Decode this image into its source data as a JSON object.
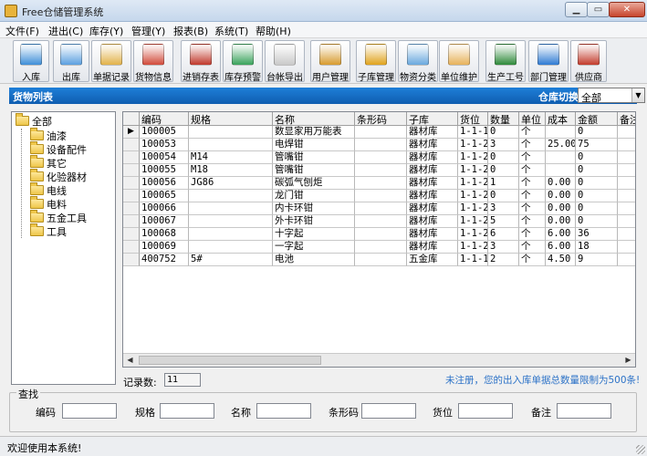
{
  "window": {
    "title": "Free仓储管理系统"
  },
  "menu": [
    "文件(F)",
    "进出(C)",
    "库存(Y)",
    "管理(Y)",
    "报表(B)",
    "系统(T)",
    "帮助(H)"
  ],
  "toolbar": [
    {
      "label": "入库",
      "icon": "warehouse-in-icon",
      "color": "#3f8fd8"
    },
    {
      "label": "出库",
      "icon": "warehouse-out-icon",
      "color": "#5ba0e0"
    },
    {
      "label": "单据记录",
      "icon": "document-edit-icon",
      "color": "#e2b24a"
    },
    {
      "label": "货物信息",
      "icon": "goods-info-icon",
      "color": "#d14a3a"
    },
    {
      "label": "进销存表",
      "icon": "report-table-icon",
      "color": "#c0392b"
    },
    {
      "label": "库存预警",
      "icon": "monitor-alert-icon",
      "color": "#3aa35b"
    },
    {
      "label": "台帐导出",
      "icon": "export-icon",
      "color": "#c9c9c9"
    },
    {
      "label": "用户管理",
      "icon": "user-icon",
      "color": "#d79b2e"
    },
    {
      "label": "子库管理",
      "icon": "sub-warehouse-icon",
      "color": "#e0a31c"
    },
    {
      "label": "物资分类",
      "icon": "category-icon",
      "color": "#6aa9de"
    },
    {
      "label": "单位维护",
      "icon": "unit-icon",
      "color": "#e7b25a"
    },
    {
      "label": "生产工号",
      "icon": "production-chart-icon",
      "color": "#2e8a3a"
    },
    {
      "label": "部门管理",
      "icon": "department-icon",
      "color": "#2f7bd3"
    },
    {
      "label": "供应商",
      "icon": "supplier-icon",
      "color": "#c23b2b"
    }
  ],
  "section": {
    "title": "货物列表",
    "warehouse_label": "仓库切换",
    "warehouse_value": "全部"
  },
  "tree": {
    "root": "全部",
    "children": [
      "油漆",
      "设备配件",
      "其它",
      "化验器材",
      "电线",
      "电料",
      "五金工具",
      "工具"
    ]
  },
  "grid": {
    "columns": [
      "编码",
      "规格",
      "名称",
      "条形码",
      "子库",
      "货位",
      "数量",
      "单位",
      "成本",
      "金额",
      "备注"
    ],
    "rows": [
      [
        "100005",
        "",
        "数显家用万能表",
        "",
        "器材库",
        "1-1-1",
        "0",
        "个",
        "",
        "0",
        ""
      ],
      [
        "100053",
        "",
        "电焊钳",
        "",
        "器材库",
        "1-1-2",
        "3",
        "个",
        "25.00",
        "75",
        ""
      ],
      [
        "100054",
        "M14",
        "管嘴钳",
        "",
        "器材库",
        "1-1-2",
        "0",
        "个",
        "",
        "0",
        ""
      ],
      [
        "100055",
        "M18",
        "管嘴钳",
        "",
        "器材库",
        "1-1-2",
        "0",
        "个",
        "",
        "0",
        ""
      ],
      [
        "100056",
        "JG86",
        "碳弧气刨炬",
        "",
        "器材库",
        "1-1-2",
        "1",
        "个",
        "0.00",
        "0",
        ""
      ],
      [
        "100065",
        "",
        "龙门钳",
        "",
        "器材库",
        "1-1-2",
        "0",
        "个",
        "0.00",
        "0",
        ""
      ],
      [
        "100066",
        "",
        "内卡环钳",
        "",
        "器材库",
        "1-1-2",
        "3",
        "个",
        "0.00",
        "0",
        ""
      ],
      [
        "100067",
        "",
        "外卡环钳",
        "",
        "器材库",
        "1-1-2",
        "5",
        "个",
        "0.00",
        "0",
        ""
      ],
      [
        "100068",
        "",
        "十字起",
        "",
        "器材库",
        "1-1-2",
        "6",
        "个",
        "6.00",
        "36",
        ""
      ],
      [
        "100069",
        "",
        "一字起",
        "",
        "器材库",
        "1-1-2",
        "3",
        "个",
        "6.00",
        "18",
        ""
      ],
      [
        "400752",
        "5#",
        "电池",
        "",
        "五金库",
        "1-1-1",
        "2",
        "个",
        "4.50",
        "9",
        ""
      ]
    ],
    "selected_row": 0
  },
  "record_count": {
    "label": "记录数:",
    "value": "11"
  },
  "notice": "未注册，您的出入库单据总数量限制为500条!",
  "query": {
    "legend": "查找",
    "fields": [
      "编码",
      "规格",
      "名称",
      "条形码",
      "货位",
      "备注"
    ]
  },
  "status": "欢迎使用本系统!"
}
